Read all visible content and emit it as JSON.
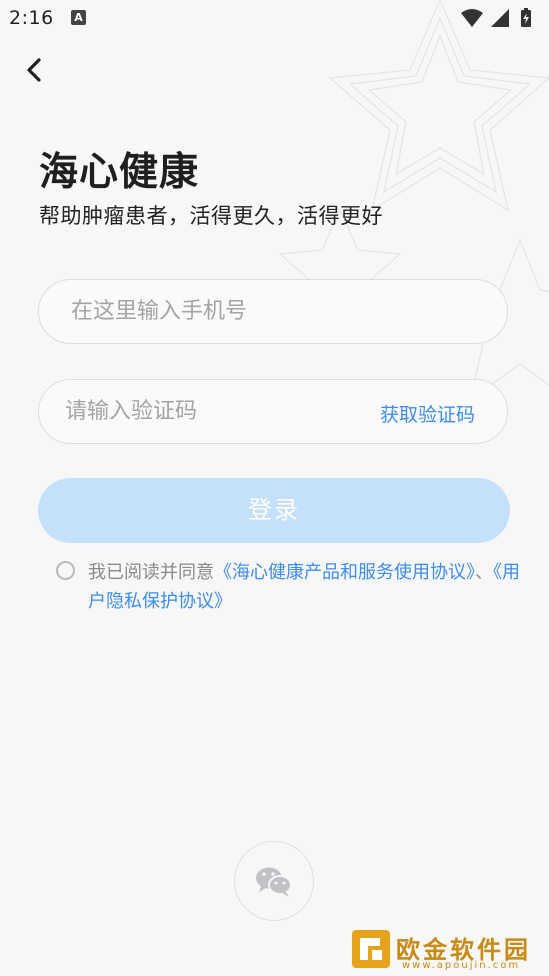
{
  "status_bar": {
    "time": "2:16",
    "notification_icon": "A"
  },
  "header": {
    "back_icon": "chevron-left-icon"
  },
  "brand": {
    "title": "海心健康",
    "slogan": "帮助肿瘤患者，活得更久，活得更好"
  },
  "form": {
    "phone_placeholder": "在这里输入手机号",
    "code_placeholder": "请输入验证码",
    "get_code_label": "获取验证码",
    "login_label": "登录"
  },
  "agreement": {
    "prefix": "我已阅读并同意",
    "link_service": "《海心健康产品和服务使用协议》",
    "separator": "、",
    "link_privacy": "《用户隐私保护协议》"
  },
  "social_login": {
    "icon": "wechat-icon"
  },
  "watermark": {
    "text": "欧金软件园",
    "url": "www.apoujin.com"
  },
  "colors": {
    "accent": "#3d8cf0",
    "login_disabled": "#c5e0fb",
    "background": "#f7f7f8"
  }
}
